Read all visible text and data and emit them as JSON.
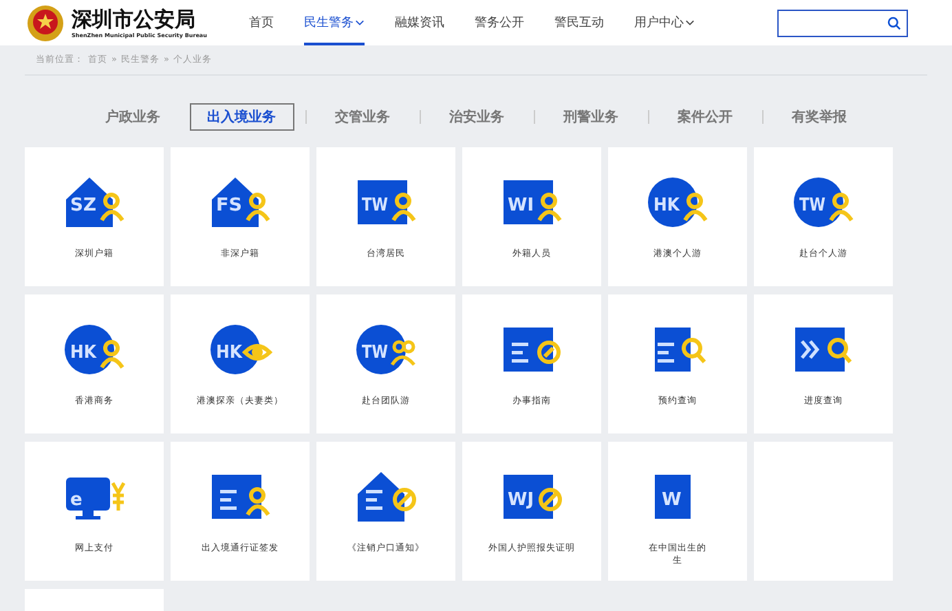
{
  "header": {
    "title": "深圳市公安局",
    "subtitle": "ShenZhen Municipal Public Security Bureau",
    "nav": [
      {
        "label": "首页",
        "selected": false,
        "dropdown": false
      },
      {
        "label": "民生警务",
        "selected": true,
        "dropdown": true
      },
      {
        "label": "融媒资讯",
        "selected": false,
        "dropdown": false
      },
      {
        "label": "警务公开",
        "selected": false,
        "dropdown": false
      },
      {
        "label": "警民互动",
        "selected": false,
        "dropdown": false
      },
      {
        "label": "用户中心",
        "selected": false,
        "dropdown": true
      }
    ]
  },
  "breadcrumb": {
    "label": "当前位置：",
    "items": [
      "首页",
      "民生警务",
      "个人业务"
    ],
    "separator": "»"
  },
  "tabs": [
    {
      "label": "户政业务",
      "selected": false
    },
    {
      "label": "出入境业务",
      "selected": true
    },
    {
      "label": "交管业务",
      "selected": false
    },
    {
      "label": "治安业务",
      "selected": false
    },
    {
      "label": "刑警业务",
      "selected": false
    },
    {
      "label": "案件公开",
      "selected": false
    },
    {
      "label": "有奖举报",
      "selected": false
    }
  ],
  "cards": [
    {
      "kind": "service",
      "icon": {
        "kind": "house"
      },
      "glyph": "SZ",
      "badge": {
        "kind": "person"
      },
      "lines": [
        "深圳户籍"
      ]
    },
    {
      "kind": "service",
      "icon": {
        "kind": "house"
      },
      "glyph": "FS",
      "badge": {
        "kind": "person"
      },
      "lines": [
        "非深户籍"
      ]
    },
    {
      "kind": "service",
      "icon": {
        "kind": "square"
      },
      "glyph": "TW",
      "badge": {
        "kind": "person"
      },
      "lines": [
        "台湾居民"
      ]
    },
    {
      "kind": "service",
      "icon": {
        "kind": "square"
      },
      "glyph": "WI",
      "badge": {
        "kind": "person"
      },
      "lines": [
        "外籍人员"
      ]
    },
    {
      "kind": "service",
      "icon": {
        "kind": "circle"
      },
      "glyph": "HK",
      "badge": {
        "kind": "person"
      },
      "lines": [
        "港澳个人游"
      ]
    },
    {
      "kind": "service",
      "icon": {
        "kind": "circle"
      },
      "glyph": "TW",
      "badge": {
        "kind": "person"
      },
      "lines": [
        "赴台个人游"
      ]
    },
    {
      "kind": "service",
      "icon": {
        "kind": "circle"
      },
      "glyph": "HK",
      "badge": {
        "kind": "person"
      },
      "lines": [
        "香港商务"
      ]
    },
    {
      "kind": "service",
      "icon": {
        "kind": "circle"
      },
      "glyph": "HK",
      "badge": {
        "kind": "eye"
      },
      "lines": [
        "港澳探亲（夫妻类）"
      ]
    },
    {
      "kind": "service",
      "icon": {
        "kind": "circle"
      },
      "glyph": "TW",
      "badge": {
        "kind": "group"
      },
      "lines": [
        "赴台团队游"
      ]
    },
    {
      "kind": "service",
      "icon": {
        "kind": "doc"
      },
      "badge": {
        "kind": "compass"
      },
      "lines": [
        "办事指南"
      ]
    },
    {
      "kind": "service",
      "icon": {
        "kind": "narrowdoc"
      },
      "badge": {
        "kind": "search"
      },
      "lines": [
        "预约查询"
      ]
    },
    {
      "kind": "service",
      "icon": {
        "kind": "arrows"
      },
      "badge": {
        "kind": "search"
      },
      "lines": [
        "进度查询"
      ]
    },
    {
      "kind": "service",
      "icon": {
        "kind": "monitor"
      },
      "glyph": "e",
      "badge": {
        "kind": "yen"
      },
      "lines": [
        "网上支付"
      ]
    },
    {
      "kind": "service",
      "icon": {
        "kind": "doc"
      },
      "badge": {
        "kind": "person"
      },
      "lines": [
        "出入境通行证签发"
      ]
    },
    {
      "kind": "service",
      "icon": {
        "kind": "housedoc"
      },
      "badge": {
        "kind": "forbid"
      },
      "lines": [
        "《注销户口通知》"
      ]
    },
    {
      "kind": "service",
      "icon": {
        "kind": "square"
      },
      "glyph": "WJ",
      "badge": {
        "kind": "forbid"
      },
      "lines": [
        "外国人护照报失证明"
      ]
    },
    {
      "kind": "service",
      "icon": {
        "kind": "narrow"
      },
      "glyph": "W",
      "lines": [
        "在中国出生的",
        "生"
      ]
    },
    {
      "kind": "blank"
    },
    {
      "kind": "blank"
    }
  ]
}
